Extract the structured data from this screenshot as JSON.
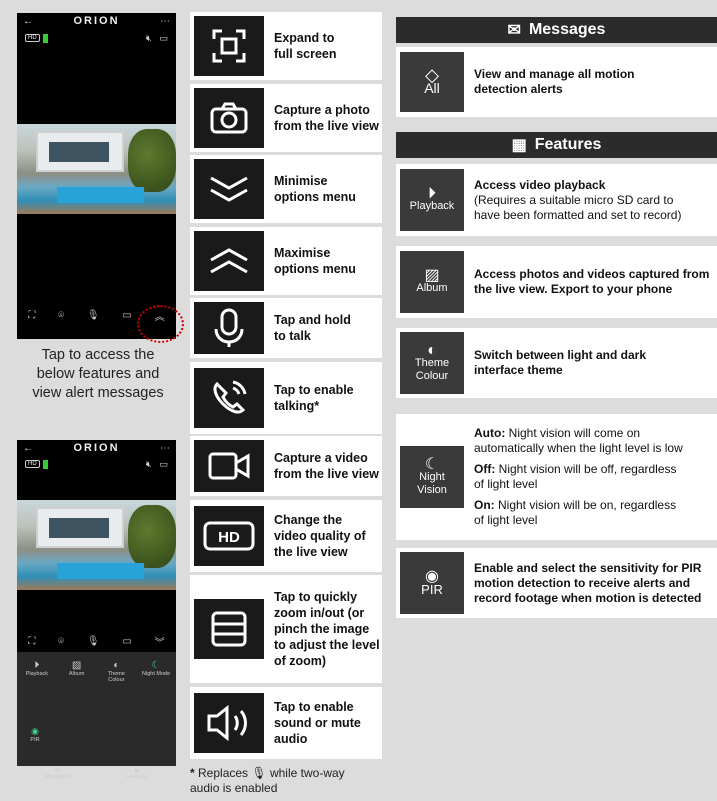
{
  "phone1": {
    "logo": "ORION",
    "hd": "HD"
  },
  "phone2": {
    "logo": "ORION",
    "hd": "HD",
    "features": [
      "Playback",
      "Album",
      "Theme Colour",
      "Night Mode",
      "PIR"
    ],
    "tabs": [
      "Messages",
      "Features"
    ]
  },
  "caption": [
    "Tap to access the",
    "below features and",
    "view alert messages"
  ],
  "controls": [
    {
      "icon": "expand-icon",
      "text": [
        "Expand to",
        "full screen"
      ]
    },
    {
      "icon": "camera-icon",
      "text": [
        "Capture a photo",
        "from the live view"
      ]
    },
    {
      "icon": "minimise-icon",
      "text": [
        "Minimise",
        "options menu"
      ]
    },
    {
      "icon": "maximise-icon",
      "text": [
        "Maximise",
        "options menu"
      ]
    },
    {
      "icon": "mic-icon",
      "text": [
        "Tap and hold",
        "to talk"
      ]
    },
    {
      "icon": "phone-talk-icon",
      "text": [
        "Tap to enable",
        "talking*"
      ]
    },
    {
      "icon": "video-icon",
      "text": [
        "Capture a video",
        "from the live view"
      ]
    },
    {
      "icon": "hd-icon",
      "text": [
        "Change the",
        "video quality of",
        "the live view"
      ]
    },
    {
      "icon": "zoom-icon",
      "text": [
        "Tap to quickly",
        "zoom in/out (or",
        "pinch the image",
        "to adjust the level",
        "of zoom)"
      ]
    },
    {
      "icon": "speaker-icon",
      "text": [
        "Tap to enable",
        "sound or mute",
        "audio"
      ]
    }
  ],
  "footnote": {
    "star": "*",
    "before": "Replaces",
    "after": "while two-way",
    "line2": "audio is enabled"
  },
  "messages": {
    "header": "Messages",
    "item": {
      "label": "All",
      "text": [
        "View and manage all motion",
        "detection alerts"
      ]
    }
  },
  "features": {
    "header": "Features",
    "playback": {
      "label": "Playback",
      "title": "Access video playback",
      "text": [
        "(Requires a suitable micro SD card to",
        "have been formatted and set to record)"
      ]
    },
    "album": {
      "label": "Album",
      "text": [
        "Access photos and videos captured from",
        "the live view. Export to your phone"
      ]
    },
    "theme": {
      "label1": "Theme",
      "label2": "Colour",
      "text": [
        "Switch between light and dark",
        "interface theme"
      ]
    },
    "night": {
      "label1": "Night",
      "label2": "Vision",
      "auto_k": "Auto:",
      "auto_v1": " Night vision will come on",
      "auto_v2": "automatically when the light level is low",
      "off_k": "Off:",
      "off_v1": " Night vision will be off, regardless",
      "off_v2": "of light level",
      "on_k": "On:",
      "on_v1": " Night vision will be on, regardless",
      "on_v2": "of light level"
    },
    "pir": {
      "label": "PIR",
      "text": [
        "Enable and select the sensitivity for PIR",
        "motion detection to receive alerts and",
        "record footage when motion is detected"
      ]
    }
  }
}
